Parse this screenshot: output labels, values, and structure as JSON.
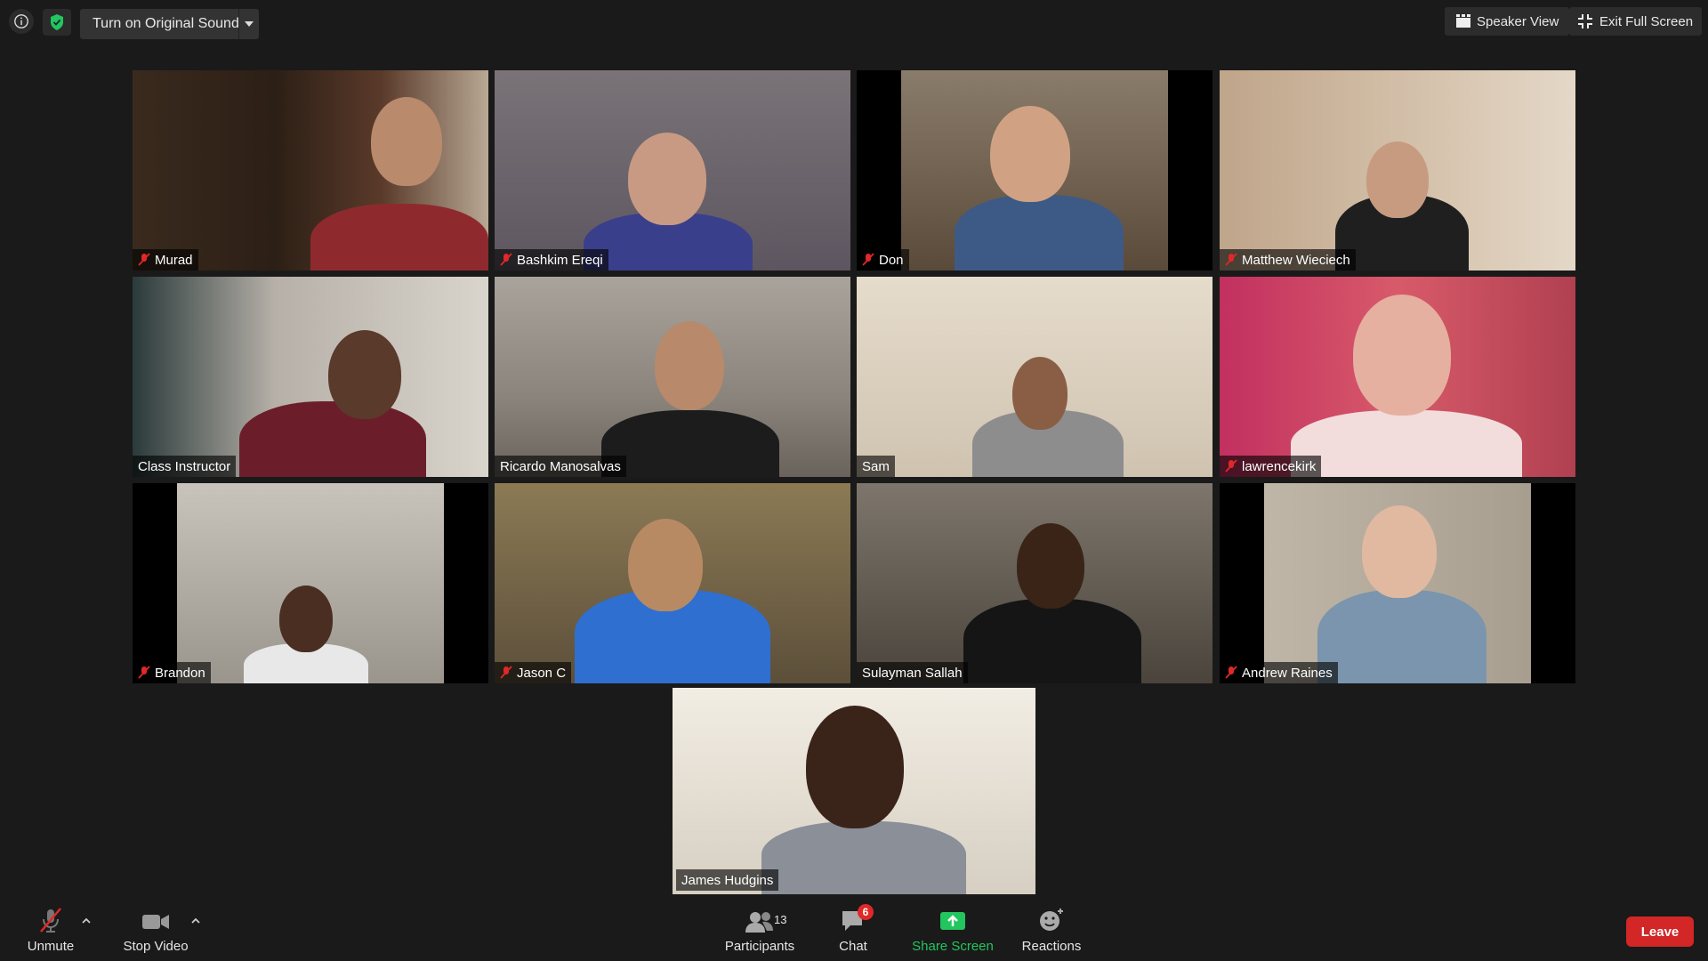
{
  "topbar": {
    "original_sound_label": "Turn on Original Sound",
    "speaker_view_label": "Speaker View",
    "exit_fullscreen_label": "Exit Full Screen",
    "security_color": "#22c55e"
  },
  "participants": [
    {
      "name": "Murad",
      "muted": true
    },
    {
      "name": "Bashkim Ereqi",
      "muted": true
    },
    {
      "name": "Don",
      "muted": true
    },
    {
      "name": "Matthew Wieciech",
      "muted": true
    },
    {
      "name": "Class Instructor",
      "muted": false
    },
    {
      "name": "Ricardo Manosalvas",
      "muted": false
    },
    {
      "name": "Sam",
      "muted": false
    },
    {
      "name": "lawrencekirk",
      "muted": true
    },
    {
      "name": "Brandon",
      "muted": true
    },
    {
      "name": "Jason C",
      "muted": true
    },
    {
      "name": "Sulayman Sallah",
      "muted": false
    },
    {
      "name": "Andrew Raines",
      "muted": true
    },
    {
      "name": "James Hudgins",
      "muted": false,
      "active_speaker": true
    }
  ],
  "toolbar": {
    "unmute_label": "Unmute",
    "stop_video_label": "Stop Video",
    "participants_label": "Participants",
    "participants_count": "13",
    "chat_label": "Chat",
    "chat_badge": "6",
    "share_label": "Share Screen",
    "reactions_label": "Reactions",
    "leave_label": "Leave",
    "share_color": "#22c55e",
    "leave_color": "#d32626"
  },
  "colors": {
    "background": "#1a1a1a",
    "active_speaker_border": "#c7e82b",
    "mute_red": "#e02828"
  }
}
